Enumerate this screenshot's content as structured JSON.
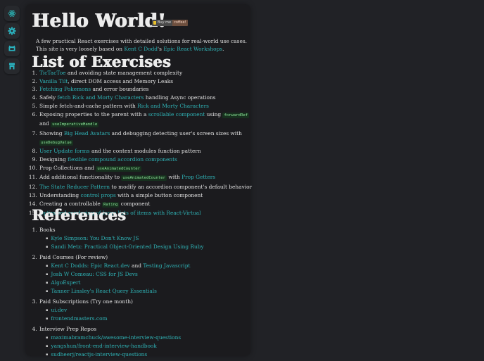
{
  "sidebar": {
    "items": [
      {
        "icon": "react-icon",
        "label": "React"
      },
      {
        "icon": "gear-icon",
        "label": "Settings"
      },
      {
        "icon": "github-icon",
        "label": "GitHub"
      },
      {
        "icon": "store-icon",
        "label": "Store"
      }
    ]
  },
  "colors": {
    "accent": "#2fb3b6",
    "background": "#212226",
    "panel": "#1b1b1e",
    "code_bg": "#17301e",
    "code_fg": "#8ee69a"
  },
  "header": {
    "title": "Hello World!",
    "coffee_badge": {
      "left": "Buy me",
      "right": "coffee!"
    }
  },
  "intro": {
    "text1": "A few practical React exercises with detailed solutions for real-world use cases. This site is very loosely based on ",
    "link1": "Kent C Dodd",
    "text2": "'s ",
    "link2": "Epic React Workshops",
    "text3": "."
  },
  "exercises": {
    "heading": "List of Exercises",
    "items": [
      {
        "link": "TicTacToe",
        "after": " and avoiding state management complexity"
      },
      {
        "link": "Vanilla Tilt",
        "after": ", direct DOM access and Memory Leaks"
      },
      {
        "link": "Fetching Pokemons",
        "after": " and error boundaries"
      },
      {
        "before": "Safely ",
        "link": "fetch Rick and Morty Characters",
        "after": " handling Async operations"
      },
      {
        "before": "Simple fetch-and-cache pattern with ",
        "link": "Rick and Morty Characters"
      },
      {
        "before": "Exposing properties to the parent with a ",
        "link": "scrollable component",
        "mid": " using ",
        "code1": "forwardRef",
        "mid2": " and ",
        "code2": "useImperativeHandle"
      },
      {
        "before": "Showing ",
        "link": "Big Head Avatars",
        "after": " and debugging detecting user's screen sizes with ",
        "code": "useDebugValue"
      },
      {
        "link": "User Update forms",
        "after": " and the context modules function pattern"
      },
      {
        "before": "Designing ",
        "link": "flexible compound accordion components"
      },
      {
        "before": "Prop Collections and ",
        "code": "useAnimatedCounter"
      },
      {
        "before": "Add additional functionality to ",
        "code": "useAnimatedCounter",
        "mid": " with ",
        "link": "Prop Getters"
      },
      {
        "link": "The State Reducer Pattern",
        "after": " to modify an accordion component's default behavior"
      },
      {
        "before": "Understanding ",
        "link": "control props",
        "after": " with a simple button component"
      },
      {
        "before": "Creating a controllable ",
        "code": "Rating",
        "after": " component"
      },
      {
        "link": "Optimized rendering of large lists of items with React-Virtual"
      }
    ]
  },
  "references": {
    "heading": "References",
    "groups": [
      {
        "label": "Books",
        "links": [
          "Kyle Simpson: You Don't Know JS",
          "Sandi Metz: Practical Object-Oriented Design Using Ruby"
        ]
      },
      {
        "label": "Paid Courses (For review)",
        "links": [
          "Kent C Dodds: Epic React.dev",
          "Testing Javascript",
          "Josh W Comeau: CSS for JS Devs",
          "AlgoExpert",
          "Tanner Linsley's React Query Essentials"
        ],
        "joiner": " and "
      },
      {
        "label": "Paid Subscriptions (Try one month)",
        "links": [
          "ui.dev",
          "frontendmasters.com"
        ]
      },
      {
        "label": "Interview Prep Repos",
        "links": [
          "maximabramchuck/awesome-interview-questions",
          "yangshun/front-end-interview-handbook",
          "sudheerj/reactjs-interview-questions"
        ]
      }
    ]
  }
}
